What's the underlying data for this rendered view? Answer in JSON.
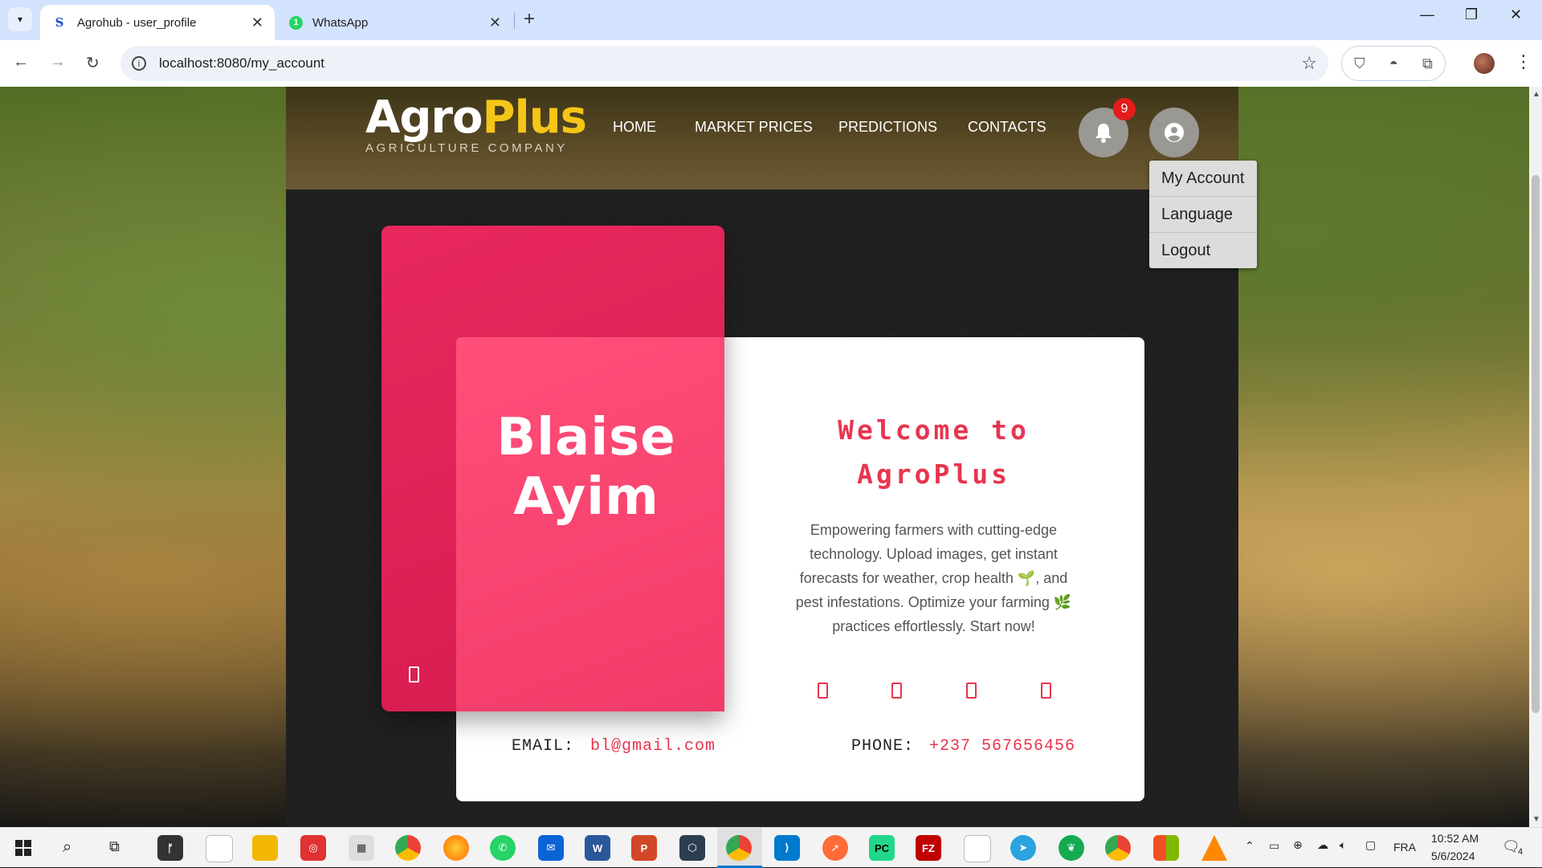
{
  "browser": {
    "tabs": [
      {
        "favicon": "S",
        "title": "Agrohub - user_profile",
        "active": true
      },
      {
        "favicon": "1",
        "title": "WhatsApp",
        "active": false
      }
    ],
    "url": "localhost:8080/my_account"
  },
  "site": {
    "logo_main_a": "Agro",
    "logo_main_b": "Plus",
    "logo_sub": "AGRICULTURE COMPANY",
    "nav": [
      "HOME",
      "MARKET PRICES",
      "PREDICTIONS",
      "CONTACTS"
    ],
    "notification_count": "9",
    "account_menu": [
      "My Account",
      "Language",
      "Logout"
    ]
  },
  "profile": {
    "name": "Blaise Ayim",
    "welcome_line1": "Welcome to",
    "welcome_line2": "AgroPlus",
    "description": "Empowering farmers with cutting-edge technology. Upload images, get instant forecasts for weather, crop health 🌱, and pest infestations. Optimize your farming 🌿 practices effortlessly. Start now!",
    "email_label": "EMAIL:",
    "email": "bl@gmail.com",
    "phone_label": "PHONE:",
    "phone": "+237 567656456"
  },
  "taskbar": {
    "language": "FRA",
    "time": "10:52 AM",
    "date": "5/6/2024",
    "notifications": "4"
  },
  "colors": {
    "accent": "#e8354f",
    "pink_card": "#f23b68",
    "logo_yellow": "#f5c518",
    "badge_red": "#e61b1b"
  }
}
